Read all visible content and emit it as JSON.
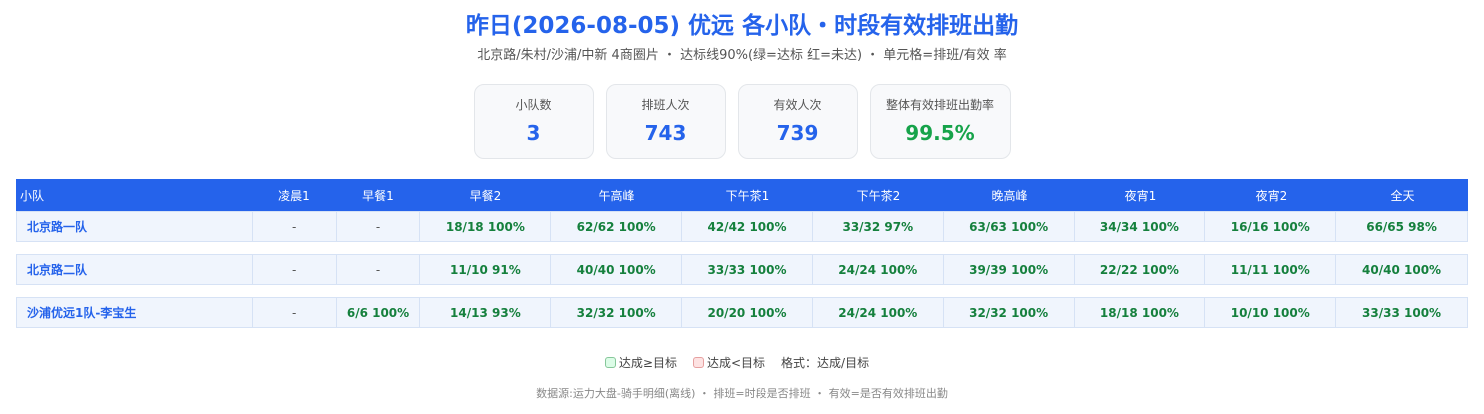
{
  "header": {
    "title": "昨日(2026-08-05) 优远 各小队・时段有效排班出勤",
    "subtitle": "北京路/朱村/沙浦/中新 4商圈片 ・ 达标线90%(绿=达标 红=未达) ・ 单元格=排班/有效 率"
  },
  "cards": [
    {
      "label": "小队数",
      "value": "3"
    },
    {
      "label": "排班人次",
      "value": "743"
    },
    {
      "label": "有效人次",
      "value": "739"
    },
    {
      "label": "整体有效排班出勤率",
      "value": "99.5%"
    }
  ],
  "table": {
    "columns": [
      "小队",
      "凌晨1",
      "早餐1",
      "早餐2",
      "午高峰",
      "下午茶1",
      "下午茶2",
      "晚高峰",
      "夜宵1",
      "夜宵2",
      "全天"
    ],
    "rows": [
      {
        "name": "北京路一队",
        "cells": [
          "-",
          "-",
          "18/18 100%",
          "62/62 100%",
          "42/42 100%",
          "33/32 97%",
          "63/63 100%",
          "34/34 100%",
          "16/16 100%",
          "66/65 98%"
        ]
      },
      {
        "name": "北京路二队",
        "cells": [
          "-",
          "-",
          "11/10 91%",
          "40/40 100%",
          "33/33 100%",
          "24/24 100%",
          "39/39 100%",
          "22/22 100%",
          "11/11 100%",
          "40/40 100%"
        ]
      },
      {
        "name": "沙浦优远1队-李宝生",
        "cells": [
          "-",
          "6/6 100%",
          "14/13 93%",
          "32/32 100%",
          "20/20 100%",
          "24/24 100%",
          "32/32 100%",
          "18/18 100%",
          "10/10 100%",
          "33/33 100%"
        ]
      }
    ]
  },
  "legend": {
    "ok": "达成≥目标",
    "bad": "达成<目标",
    "format": "格式：达成/目标"
  },
  "footer": "数据源:运力大盘-骑手明细(离线) ・ 排班=时段是否排班 ・ 有效=是否有效排班出勤",
  "colors": {
    "accent": "#2563eb",
    "ok": "#16a34a",
    "header_bg": "#2563eb"
  }
}
